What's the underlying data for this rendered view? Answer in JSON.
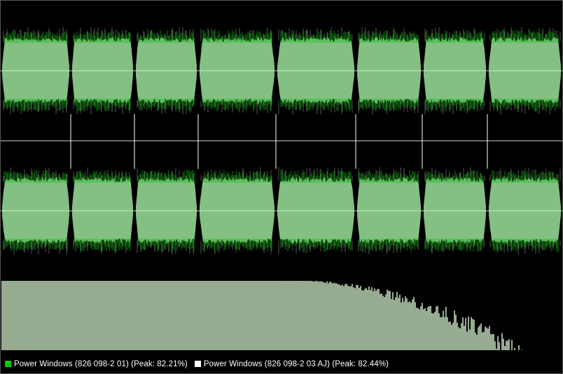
{
  "colors": {
    "background": "#000000",
    "channel_a": "#00c800",
    "channel_b": "#ffffff",
    "overlap": "#84bf84",
    "spectrum": "#d8f4d0",
    "divider": "#8a8a8a"
  },
  "waveform": {
    "channels": 2,
    "track_boundaries": [
      0.125,
      0.238,
      0.352,
      0.49,
      0.632,
      0.75,
      0.866
    ]
  },
  "legend": {
    "items": [
      {
        "label": "Power Windows (826 098-2 01) (Peak: 82.21%)",
        "color": "#00c800",
        "icon": "green-square"
      },
      {
        "label": "Power Windows (826 098-2 03 AJ) (Peak: 82.44%)",
        "color": "#ffffff",
        "icon": "white-square"
      }
    ]
  }
}
